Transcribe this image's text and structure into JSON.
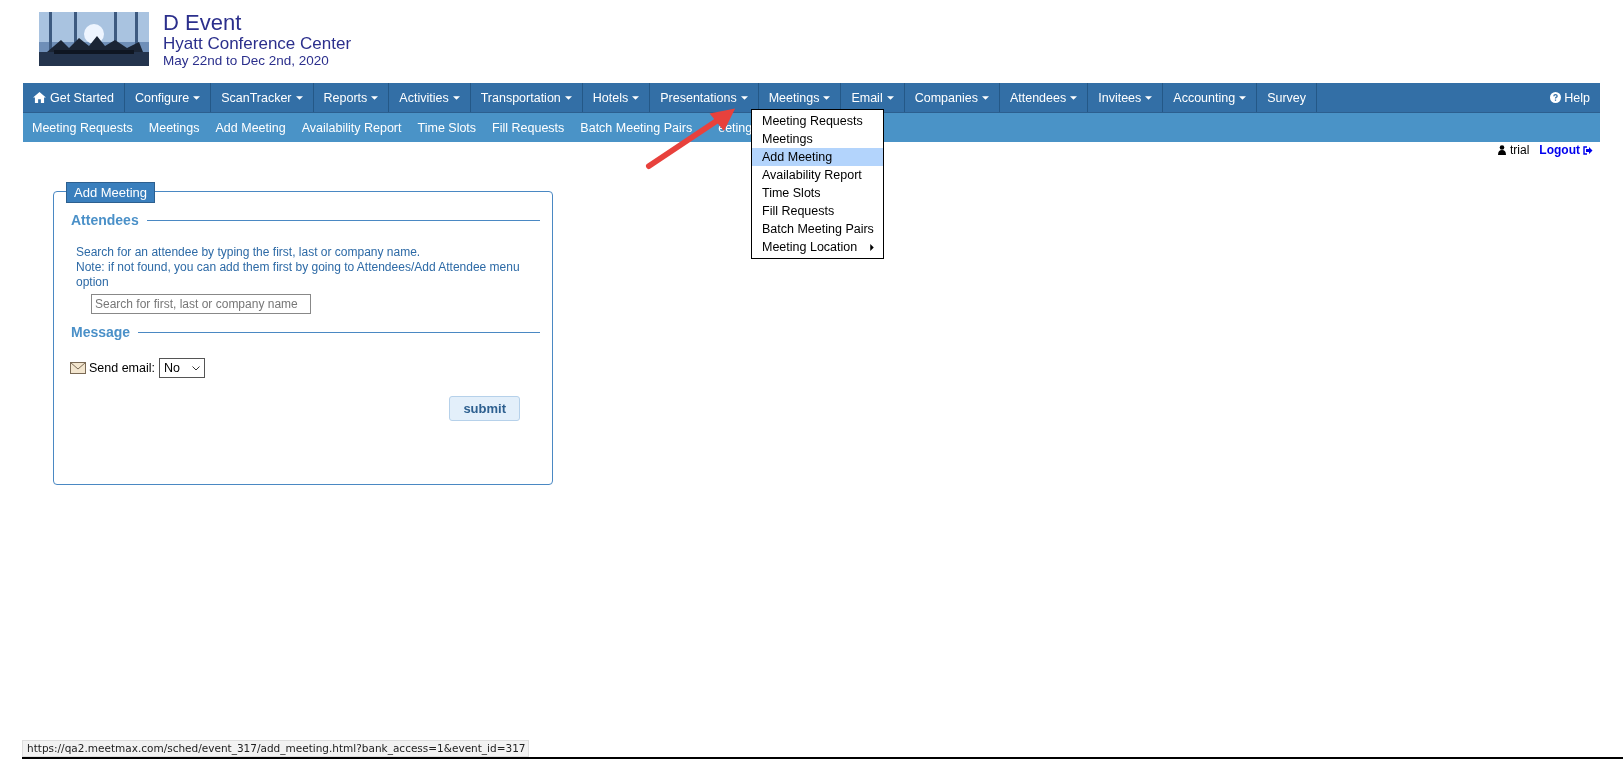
{
  "header": {
    "event_name": "D Event",
    "venue": "Hyatt Conference Center",
    "dates": "May 22nd to Dec 2nd, 2020"
  },
  "nav": {
    "items": [
      {
        "label": "Get Started",
        "kind": "home",
        "dropdown": false
      },
      {
        "label": "Configure",
        "kind": "plain",
        "dropdown": true
      },
      {
        "label": "ScanTracker",
        "kind": "plain",
        "dropdown": true
      },
      {
        "label": "Reports",
        "kind": "plain",
        "dropdown": true
      },
      {
        "label": "Activities",
        "kind": "plain",
        "dropdown": true
      },
      {
        "label": "Transportation",
        "kind": "plain",
        "dropdown": true
      },
      {
        "label": "Hotels",
        "kind": "plain",
        "dropdown": true
      },
      {
        "label": "Presentations",
        "kind": "plain",
        "dropdown": true
      },
      {
        "label": "Meetings",
        "kind": "plain",
        "dropdown": true
      },
      {
        "label": "Email",
        "kind": "plain",
        "dropdown": true
      },
      {
        "label": "Companies",
        "kind": "plain",
        "dropdown": true
      },
      {
        "label": "Attendees",
        "kind": "plain",
        "dropdown": true
      },
      {
        "label": "Invitees",
        "kind": "plain",
        "dropdown": true
      },
      {
        "label": "Accounting",
        "kind": "plain",
        "dropdown": true
      },
      {
        "label": "Survey",
        "kind": "plain",
        "dropdown": false
      }
    ],
    "help": "Help"
  },
  "subnav": [
    "Meeting Requests",
    "Meetings",
    "Add Meeting",
    "Availability Report",
    "Time Slots",
    "Fill Requests",
    "Batch Meeting Pairs",
    "eeting"
  ],
  "menu": [
    {
      "label": "Meeting Requests",
      "selected": false,
      "submenu": false
    },
    {
      "label": "Meetings",
      "selected": false,
      "submenu": false
    },
    {
      "label": "Add Meeting",
      "selected": true,
      "submenu": false
    },
    {
      "label": "Availability Report",
      "selected": false,
      "submenu": false
    },
    {
      "label": "Time Slots",
      "selected": false,
      "submenu": false
    },
    {
      "label": "Fill Requests",
      "selected": false,
      "submenu": false
    },
    {
      "label": "Batch Meeting Pairs",
      "selected": false,
      "submenu": false
    },
    {
      "label": "Meeting Location",
      "selected": false,
      "submenu": true
    }
  ],
  "user": {
    "name": "trial",
    "logout": "Logout"
  },
  "form": {
    "legend": "Add Meeting",
    "attendees_heading": "Attendees",
    "help_lines": [
      "Search for an attendee by typing the first, last or company name.",
      "Note: if not found, you can add them first by going to Attendees/Add Attendee menu option"
    ],
    "search_placeholder": "Search for first, last or company name",
    "message_heading": "Message",
    "send_email_label": "Send email:",
    "send_email_value": "No",
    "submit": "submit"
  },
  "status_bar": "https://qa2.meetmax.com/sched/event_317/add_meeting.html?bank_access=1&event_id=317"
}
